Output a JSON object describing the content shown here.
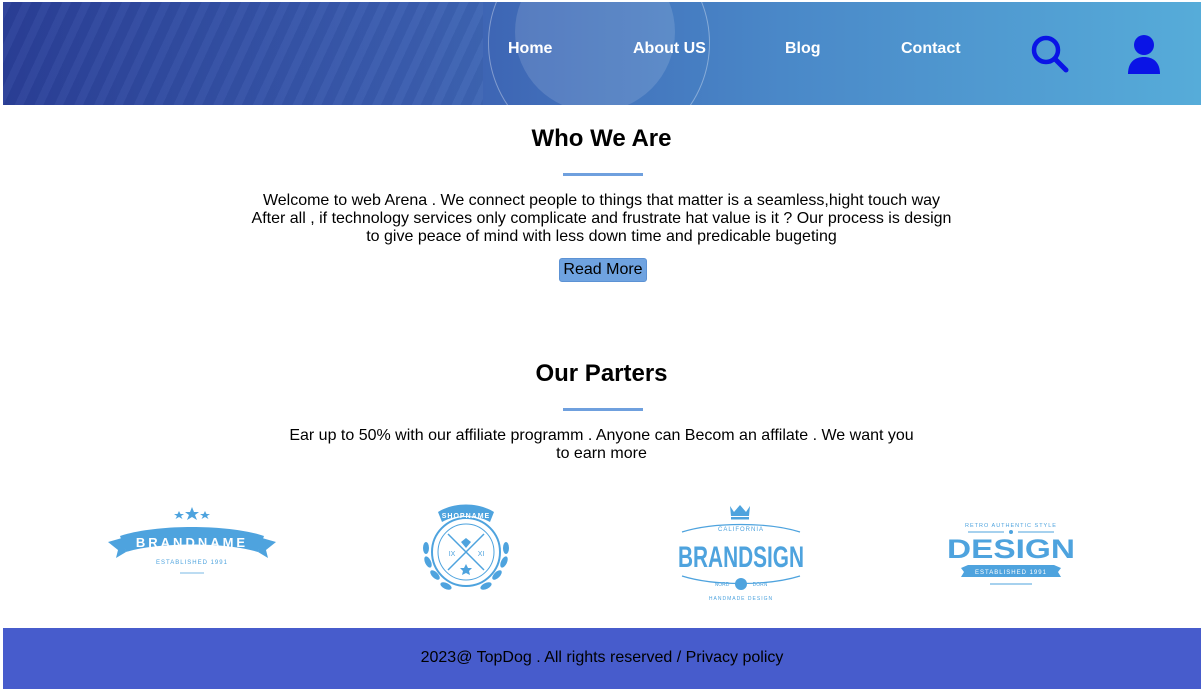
{
  "nav": {
    "items": [
      {
        "label": "Home"
      },
      {
        "label": "About US"
      },
      {
        "label": "Blog"
      },
      {
        "label": "Contact"
      }
    ],
    "search_icon": "search-icon",
    "user_icon": "user-icon"
  },
  "about": {
    "title": "Who We Are",
    "lines": [
      "Welcome to web Arena . We connect people to things that matter is a seamless,hight touch way",
      "After all , if technology services only complicate and frustrate hat value is it ? Our process is design",
      "to give peace of mind with less down time and predicable bugeting"
    ],
    "button_label": "Read More"
  },
  "partners": {
    "title": "Our Parters",
    "lines": [
      "Ear up to 50% with our affiliate programm . Anyone can Becom an affilate . We want you",
      "to earn more"
    ],
    "logos": [
      {
        "main": "BRANDNAME",
        "sub": "ESTABLISHED 1991"
      },
      {
        "main": "SHOPNAME",
        "left": "IX",
        "right": "XI"
      },
      {
        "top": "CALIFORNIA",
        "main": "BRANDSIGN",
        "left": "NORD",
        "right": "DORN",
        "sub": "HANDMADE DESIGN"
      },
      {
        "top": "RETRO AUTHENTIC STYLE",
        "main": "DESIGN",
        "sub": "ESTABLISHED 1991"
      }
    ]
  },
  "footer": {
    "text": "2023@ TopDog . All rights reserved / Privacy policy"
  },
  "colors": {
    "accent": "#6fa0de",
    "logo_blue": "#4ea3de",
    "footer_bg": "#475ccc",
    "icon_blue": "#0a14e6"
  }
}
